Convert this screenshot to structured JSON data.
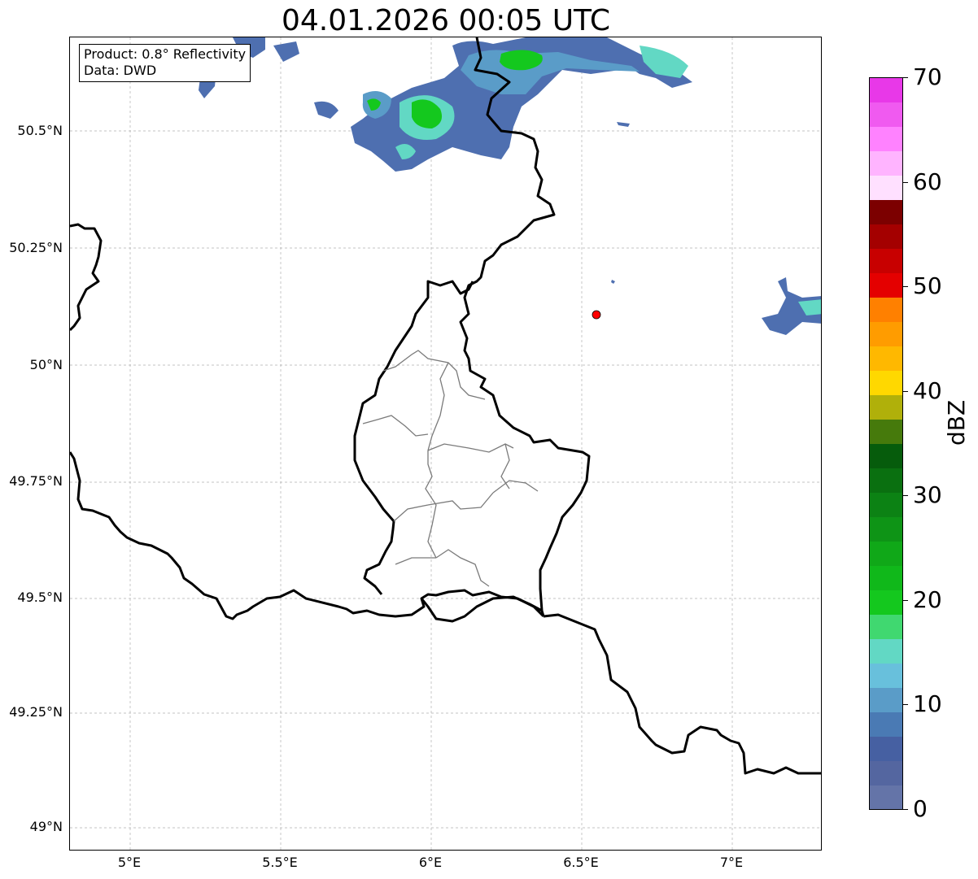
{
  "title": "04.01.2026 00:05 UTC",
  "info_box": {
    "line1": "Product: 0.8° Reflectivity",
    "line2": "Data: DWD"
  },
  "lat_labels": [
    "50.5°N",
    "50.25°N",
    "50°N",
    "49.75°N",
    "49.5°N",
    "49.25°N",
    "49°N"
  ],
  "lon_labels": [
    "5°E",
    "5.5°E",
    "6°E",
    "6.5°E",
    "7°E"
  ],
  "colorbar": {
    "unit": "dBZ",
    "range": [
      0,
      70
    ],
    "tick_labels": [
      "0",
      "10",
      "20",
      "30",
      "40",
      "50",
      "60",
      "70"
    ],
    "colors": [
      "#6474a8",
      "#5466a0",
      "#4660a2",
      "#4a7ab4",
      "#5a9cc8",
      "#68c0dc",
      "#62d8c4",
      "#40d870",
      "#14c81e",
      "#10b81a",
      "#10a818",
      "#0e9416",
      "#0c8214",
      "#0a7010",
      "#065c0c",
      "#467a0c",
      "#b0b00a",
      "#ffd800",
      "#ffb800",
      "#ff9c00",
      "#ff8000",
      "#e40000",
      "#c80000",
      "#a40000",
      "#7c0000",
      "#ffe0ff",
      "#ffb4ff",
      "#ff82ff",
      "#f05af0",
      "#e838e8"
    ]
  },
  "radar_location": {
    "lon": 6.55,
    "lat": 50.11,
    "color": "#ff0000"
  },
  "chart_data": {
    "type": "map",
    "title": "04.01.2026 00:05 UTC",
    "lon_range": [
      4.8,
      7.3
    ],
    "lat_range": [
      48.95,
      50.7
    ],
    "grid": true,
    "colorbar_unit": "dBZ",
    "colorbar_range": [
      0,
      70
    ]
  }
}
